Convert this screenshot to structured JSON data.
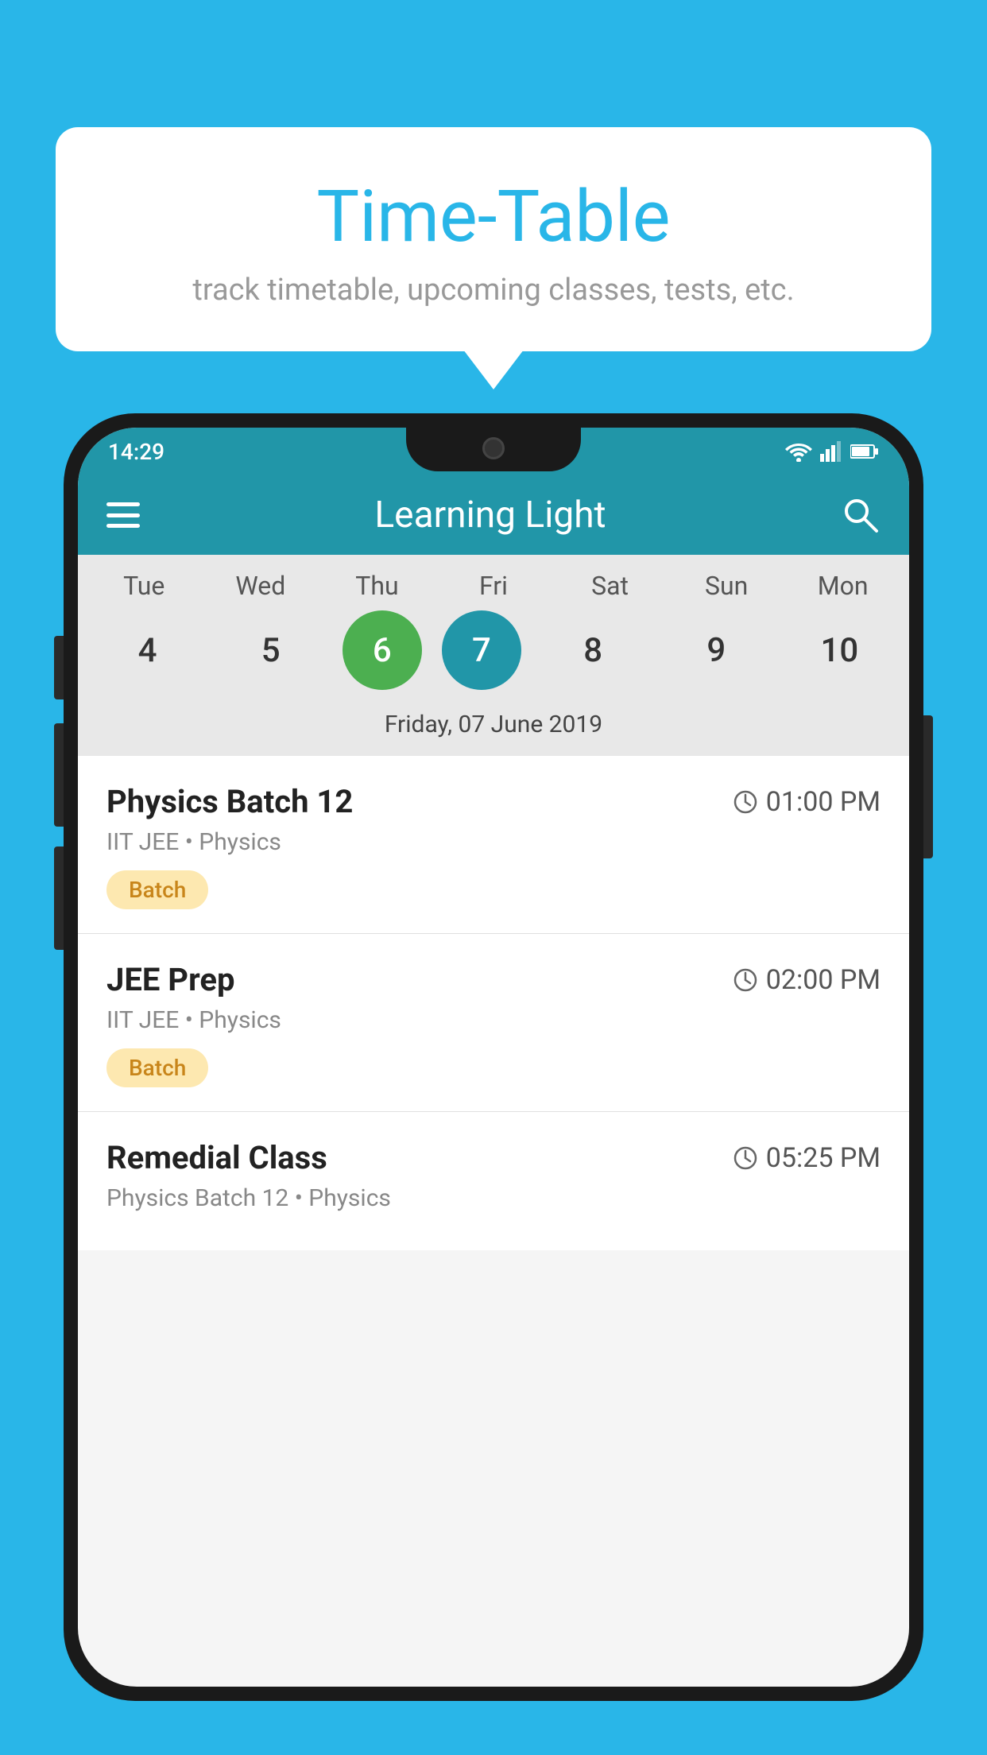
{
  "background_color": "#29b6e8",
  "bubble": {
    "title": "Time-Table",
    "subtitle": "track timetable, upcoming classes, tests, etc."
  },
  "status_bar": {
    "time": "14:29"
  },
  "app_bar": {
    "title": "Learning Light"
  },
  "calendar": {
    "days": [
      "Tue",
      "Wed",
      "Thu",
      "Fri",
      "Sat",
      "Sun",
      "Mon"
    ],
    "dates": [
      4,
      5,
      6,
      7,
      8,
      9,
      10
    ],
    "today_index": 2,
    "selected_index": 3,
    "selected_date_label": "Friday, 07 June 2019"
  },
  "schedule": [
    {
      "name": "Physics Batch 12",
      "time": "01:00 PM",
      "subtitle": "IIT JEE • Physics",
      "badge": "Batch"
    },
    {
      "name": "JEE Prep",
      "time": "02:00 PM",
      "subtitle": "IIT JEE • Physics",
      "badge": "Batch"
    },
    {
      "name": "Remedial Class",
      "time": "05:25 PM",
      "subtitle": "Physics Batch 12 • Physics",
      "badge": null
    }
  ]
}
